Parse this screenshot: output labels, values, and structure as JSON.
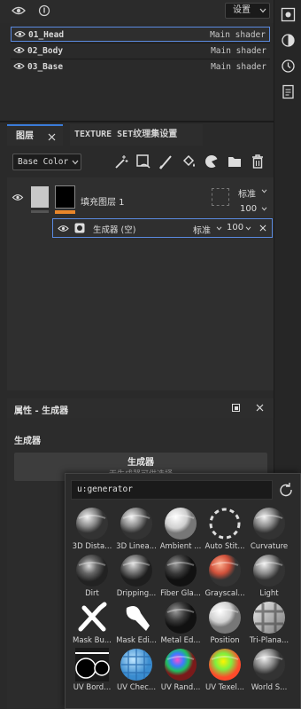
{
  "top_bar": {
    "settings_label": "设置"
  },
  "texture_sets": [
    {
      "name": "01_Head",
      "shader": "Main shader"
    },
    {
      "name": "02_Body",
      "shader": "Main shader"
    },
    {
      "name": "03_Base",
      "shader": "Main shader"
    }
  ],
  "layer_panel": {
    "tab_layers": "图层",
    "tab_texture_set": "TEXTURE SET纹理集设置",
    "channel": "Base Color",
    "fill_layer": {
      "name": "填充图层 1",
      "blend": "标准",
      "opacity": "100"
    },
    "generator": {
      "name": "生成器 (空)",
      "blend": "标准",
      "opacity": "100"
    }
  },
  "properties": {
    "title": "属性 - 生成器",
    "section": "生成器",
    "box_title": "生成器",
    "box_subtitle": "无生成器可供选择"
  },
  "popup": {
    "search": "u:generator",
    "items": [
      "3D Dista...",
      "3D Linea...",
      "Ambient ...",
      "Auto Stit...",
      "Curvature",
      "Dirt",
      "Dripping...",
      "Fiber Gla...",
      "Grayscal...",
      "Light",
      "Mask Bu...",
      "Mask Edi...",
      "Metal Ed...",
      "Position",
      "Tri-Plana...",
      "UV Bord...",
      "UV Chec...",
      "UV Rand...",
      "UV Texel...",
      "World S..."
    ]
  },
  "colors": {
    "accent": "#3b7bd8",
    "selection": "#5a8ae0",
    "opacity_bar": "#e8862a"
  }
}
